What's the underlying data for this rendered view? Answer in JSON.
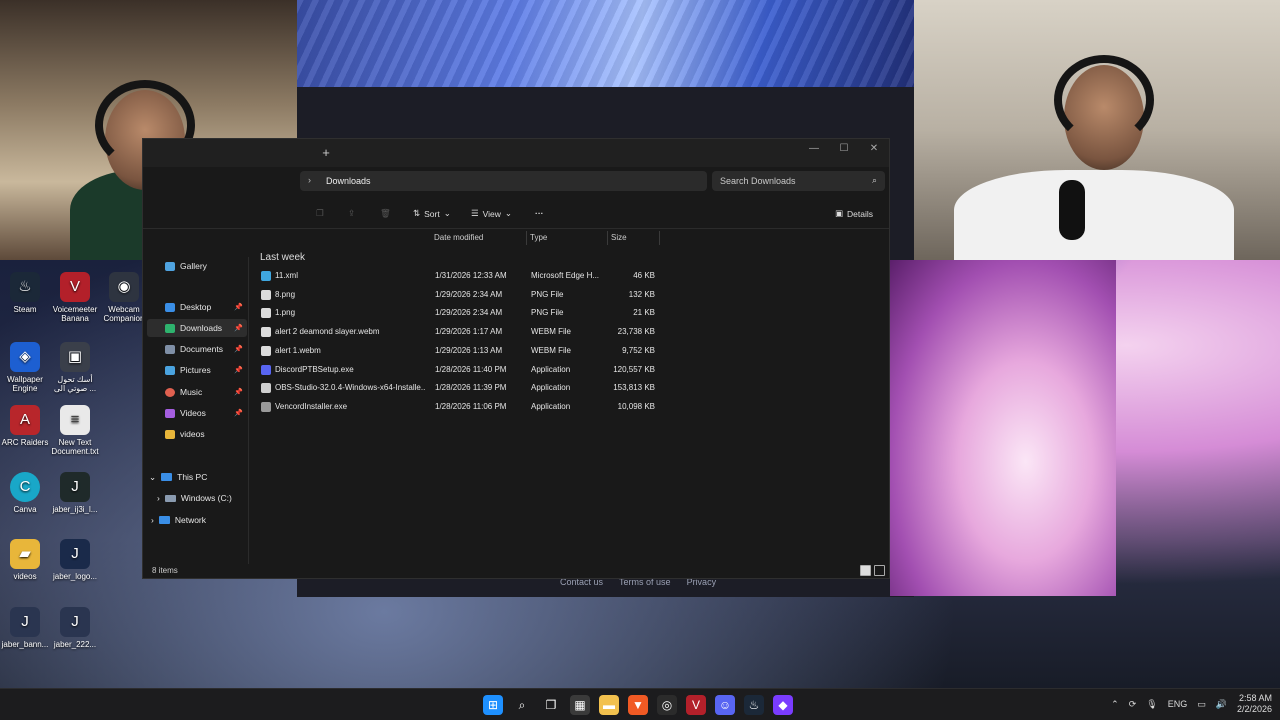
{
  "explorer": {
    "breadcrumb": "Downloads",
    "search_placeholder": "Search Downloads",
    "toolbar": {
      "sort": "Sort",
      "view": "View",
      "more": "···",
      "details": "Details"
    },
    "columns": {
      "date": "Date modified",
      "type": "Type",
      "size": "Size"
    },
    "group_label": "Last week",
    "quick_access": [
      {
        "label": "Gallery",
        "pinned": false
      },
      {
        "label": "Desktop",
        "pinned": true
      },
      {
        "label": "Downloads",
        "pinned": true
      },
      {
        "label": "Documents",
        "pinned": true
      },
      {
        "label": "Pictures",
        "pinned": true
      },
      {
        "label": "Music",
        "pinned": true
      },
      {
        "label": "Videos",
        "pinned": true
      },
      {
        "label": "videos",
        "pinned": false
      }
    ],
    "tree": {
      "this_pc": "This PC",
      "windows_c": "Windows (C:)",
      "network": "Network"
    },
    "files": [
      {
        "name": "11.xml",
        "date": "1/31/2026 12:33 AM",
        "type": "Microsoft Edge H...",
        "size": "46 KB",
        "icon_color": "#3fa7e0"
      },
      {
        "name": "8.png",
        "date": "1/29/2026 2:34 AM",
        "type": "PNG File",
        "size": "132 KB",
        "icon_color": "#dcdcdc"
      },
      {
        "name": "1.png",
        "date": "1/29/2026 2:34 AM",
        "type": "PNG File",
        "size": "21 KB",
        "icon_color": "#dcdcdc"
      },
      {
        "name": "alert 2 deamond slayer.webm",
        "date": "1/29/2026 1:17 AM",
        "type": "WEBM File",
        "size": "23,738 KB",
        "icon_color": "#dcdcdc"
      },
      {
        "name": "alert 1.webm",
        "date": "1/29/2026 1:13 AM",
        "type": "WEBM File",
        "size": "9,752 KB",
        "icon_color": "#dcdcdc"
      },
      {
        "name": "DiscordPTBSetup.exe",
        "date": "1/28/2026 11:40 PM",
        "type": "Application",
        "size": "120,557 KB",
        "icon_color": "#5865f2"
      },
      {
        "name": "OBS-Studio-32.0.4-Windows-x64-Installe...",
        "date": "1/28/2026 11:39 PM",
        "type": "Application",
        "size": "153,813 KB",
        "icon_color": "#cfcfcf"
      },
      {
        "name": "VencordInstaller.exe",
        "date": "1/28/2026 11:06 PM",
        "type": "Application",
        "size": "10,098 KB",
        "icon_color": "#9a9a9a"
      }
    ],
    "status": "8 items"
  },
  "desktop": [
    {
      "label": "Steam",
      "color": "#1b2838",
      "glyph": "♨"
    },
    {
      "label": "Voicemeeter Banana",
      "color": "#b3202a",
      "glyph": "V"
    },
    {
      "label": "Webcam Companion",
      "color": "#2e3440",
      "glyph": "◉"
    },
    {
      "label": "Wallpaper Engine",
      "color": "#1d5fd1",
      "glyph": "◈"
    },
    {
      "label": "أسك تحول صوتي الى ...",
      "color": "#3a3f4a",
      "glyph": "▣"
    },
    {
      "label": "ARC Raiders",
      "color": "#b8262b",
      "glyph": "A"
    },
    {
      "label": "New Text Document.txt",
      "color": "#e9e9e9",
      "glyph": "≡"
    },
    {
      "label": "Canva",
      "color": "#19a7c8",
      "glyph": "C"
    },
    {
      "label": "jaber_ij3i_l...",
      "color": "#1f2a2a",
      "glyph": "J"
    },
    {
      "label": "videos",
      "color": "#e8b63a",
      "glyph": "▰"
    },
    {
      "label": "jaber_logo...",
      "color": "#1a2a4a",
      "glyph": "J"
    },
    {
      "label": "jaber_bann...",
      "color": "#2a3550",
      "glyph": "J"
    },
    {
      "label": "jaber_222...",
      "color": "#2a3550",
      "glyph": "J"
    }
  ],
  "web": {
    "links": [
      "Contact us",
      "Terms of use",
      "Privacy"
    ]
  },
  "taskbar": {
    "apps": [
      {
        "name": "start",
        "color": "#1e90ff",
        "glyph": "⊞"
      },
      {
        "name": "search",
        "color": "transparent",
        "glyph": "⌕"
      },
      {
        "name": "task-view",
        "color": "transparent",
        "glyph": "❐"
      },
      {
        "name": "store",
        "color": "#3a3a3a",
        "glyph": "▦"
      },
      {
        "name": "file-explorer",
        "color": "#f2c14e",
        "glyph": "▬"
      },
      {
        "name": "brave",
        "color": "#f15a24",
        "glyph": "▼"
      },
      {
        "name": "obs",
        "color": "#2b2b2b",
        "glyph": "◎"
      },
      {
        "name": "voicemeeter",
        "color": "#b3202a",
        "glyph": "V"
      },
      {
        "name": "discord",
        "color": "#5865f2",
        "glyph": "☺"
      },
      {
        "name": "steam",
        "color": "#1b2838",
        "glyph": "♨"
      },
      {
        "name": "elgato",
        "color": "#7a3cff",
        "glyph": "◆"
      }
    ],
    "lang": "ENG",
    "time": "2:58 AM",
    "date": "2/2/2026"
  }
}
